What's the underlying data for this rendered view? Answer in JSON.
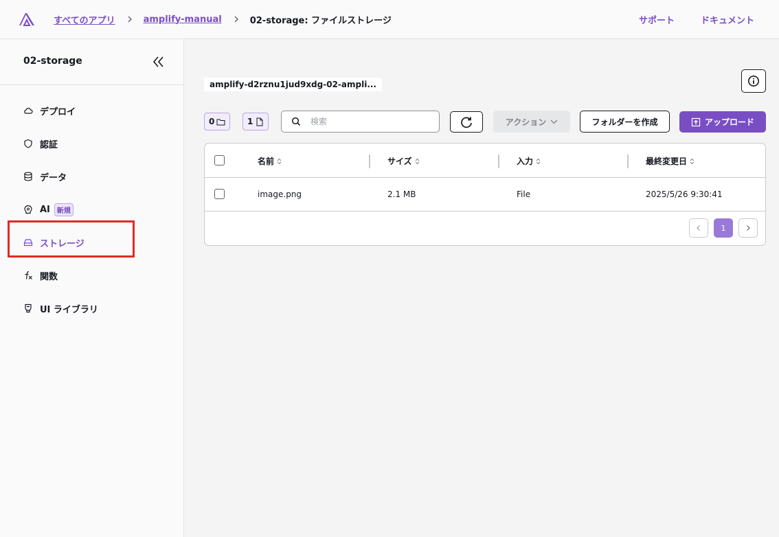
{
  "breadcrumb": {
    "all_apps": "すべてのアプリ",
    "app": "amplify-manual",
    "current": "02-storage: ファイルストレージ"
  },
  "top_links": {
    "support": "サポート",
    "docs": "ドキュメント"
  },
  "sidebar": {
    "title": "02-storage",
    "items": [
      {
        "label": "デプロイ",
        "icon": "cloud-icon"
      },
      {
        "label": "認証",
        "icon": "shield-icon"
      },
      {
        "label": "データ",
        "icon": "database-icon"
      },
      {
        "label": "AI",
        "icon": "brain-icon",
        "badge": "新規"
      },
      {
        "label": "ストレージ",
        "icon": "storage-icon",
        "active": true
      },
      {
        "label": "関数",
        "icon": "function-icon"
      },
      {
        "label": "UI ライブラリ",
        "icon": "component-icon"
      }
    ]
  },
  "main": {
    "bucket": "amplify-d2rznu1jud9xdg-02-ampli...",
    "folder_count": "0",
    "file_count": "1",
    "search_placeholder": "検索",
    "actions_label": "アクション",
    "create_folder_label": "フォルダーを作成",
    "upload_label": "アップロード"
  },
  "table": {
    "columns": [
      "名前",
      "サイズ",
      "入力",
      "最終変更日"
    ],
    "rows": [
      [
        "image.png",
        "2.1 MB",
        "File",
        "2025/5/26 9:30:41"
      ]
    ],
    "current_page": "1"
  },
  "colors": {
    "accent": "#7a4ec3",
    "highlight": "#e02a25"
  }
}
